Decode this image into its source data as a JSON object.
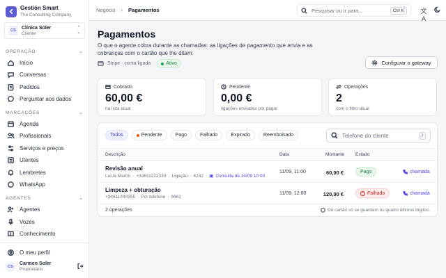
{
  "brand": {
    "name": "Gestión Smart",
    "tagline": "The Consulting Company"
  },
  "org": {
    "initials": "CS",
    "name": "Clínica Soler",
    "role": "Cliente"
  },
  "sidebar": {
    "sections": [
      {
        "title": "OPERAÇÃO",
        "items": [
          {
            "label": "Início",
            "icon": "home-icon"
          },
          {
            "label": "Conversas",
            "icon": "chat-icon"
          },
          {
            "label": "Pedidos",
            "icon": "clipboard-icon"
          },
          {
            "label": "Perguntar aos dados",
            "icon": "chat-bubble-icon"
          }
        ]
      },
      {
        "title": "MARCAÇÕES",
        "items": [
          {
            "label": "Agenda",
            "icon": "calendar-icon"
          },
          {
            "label": "Profissionais",
            "icon": "users-icon"
          },
          {
            "label": "Serviços e preços",
            "icon": "sliders-icon"
          },
          {
            "label": "Utentes",
            "icon": "user-list-icon"
          },
          {
            "label": "Lembretes",
            "icon": "bell-icon"
          },
          {
            "label": "WhatsApp",
            "icon": "whatsapp-icon"
          }
        ]
      },
      {
        "title": "AGENTES",
        "items": [
          {
            "label": "Agentes",
            "icon": "agents-icon"
          },
          {
            "label": "Vozes",
            "icon": "mic-icon"
          },
          {
            "label": "Conhecimento",
            "icon": "book-icon"
          }
        ]
      }
    ],
    "profile_link": "O meu perfil"
  },
  "user": {
    "initials": "CS",
    "name": "Carmen Soler",
    "role": "Proprietário"
  },
  "topbar": {
    "breadcrumb": [
      "Negócio",
      "Pagamentos"
    ],
    "search_placeholder": "Pesquisar ou ir para...",
    "search_shortcut": "Ctrl K"
  },
  "page": {
    "title": "Pagamentos",
    "description": "O que o agente cobra durante as chamadas: as ligações de pagamento que envia e as cobranças com o cartão que lhe ditam.",
    "provider": "Stripe · conta ligada",
    "status": "Ativo",
    "gateway_button": "Configurar o gateway"
  },
  "stats": [
    {
      "label": "Cobrado",
      "value": "60,00 €",
      "sub": "na lista atual",
      "icon": "card-icon"
    },
    {
      "label": "Pendente",
      "value": "0,00 €",
      "sub": "ligações enviadas por pagar",
      "icon": "clock-icon"
    },
    {
      "label": "Operações",
      "value": "2",
      "sub": "com o filtro atual",
      "icon": "arrows-icon"
    }
  ],
  "filters": [
    {
      "label": "Todos",
      "active": true
    },
    {
      "label": "Pendente",
      "dot": true
    },
    {
      "label": "Pago"
    },
    {
      "label": "Falhado"
    },
    {
      "label": "Expirado"
    },
    {
      "label": "Reembolsado"
    }
  ],
  "table": {
    "search_placeholder": "Telefone do cliente",
    "search_shortcut": "/",
    "columns": [
      "Descrição",
      "Data",
      "Montante",
      "Estado"
    ],
    "rows": [
      {
        "title": "Revisão anual",
        "customer": "Lucía Martín",
        "phone": "+34611222333",
        "kind": "Ligação",
        "last4": "4242",
        "link": "Consulta de 14/09 10:00",
        "date": "11/09, 11:00",
        "amount": "60,00 €",
        "status": "Pago",
        "action": "chamada"
      },
      {
        "title": "Limpeza + obturação",
        "phone": "+34611444555",
        "kind": "Por telefone",
        "last4": "0002",
        "date": "11/09, 12:00",
        "amount": "120,00 €",
        "status": "Falhado",
        "action": "chamada"
      }
    ],
    "count": "2 operações",
    "note": "Do cartão só se guardam os quatro últimos dígitos."
  }
}
